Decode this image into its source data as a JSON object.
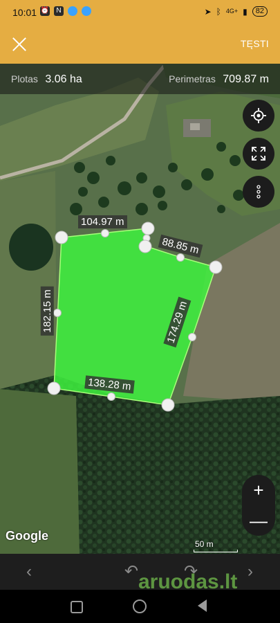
{
  "status_bar": {
    "time": "10:01",
    "network": "4G+",
    "battery": "82"
  },
  "app_bar": {
    "continue_label": "TĘSTI"
  },
  "info_bar": {
    "area_label": "Plotas",
    "area_value": "3.06 ha",
    "perimeter_label": "Perimetras",
    "perimeter_value": "709.87 m"
  },
  "map": {
    "provider": "Google",
    "scale_label": "50 m",
    "polygon_fill": "#3ef23e",
    "segment_labels": [
      "104.97 m",
      "88.85 m",
      "174.29 m",
      "138.28 m",
      "182.15 m"
    ]
  },
  "map_controls": {
    "locate_icon": "crosshair-icon",
    "fit_icon": "expand-icon",
    "more_icon": "more-vertical-icon",
    "zoom_in": "+",
    "zoom_out": "—"
  },
  "toolbar": {
    "prev_icon": "chevron-left-icon",
    "undo_icon": "undo-icon",
    "redo_icon": "redo-icon",
    "next_icon": "chevron-right-icon"
  },
  "watermark": {
    "text_a": "aruodas",
    "text_b": ".lt"
  }
}
